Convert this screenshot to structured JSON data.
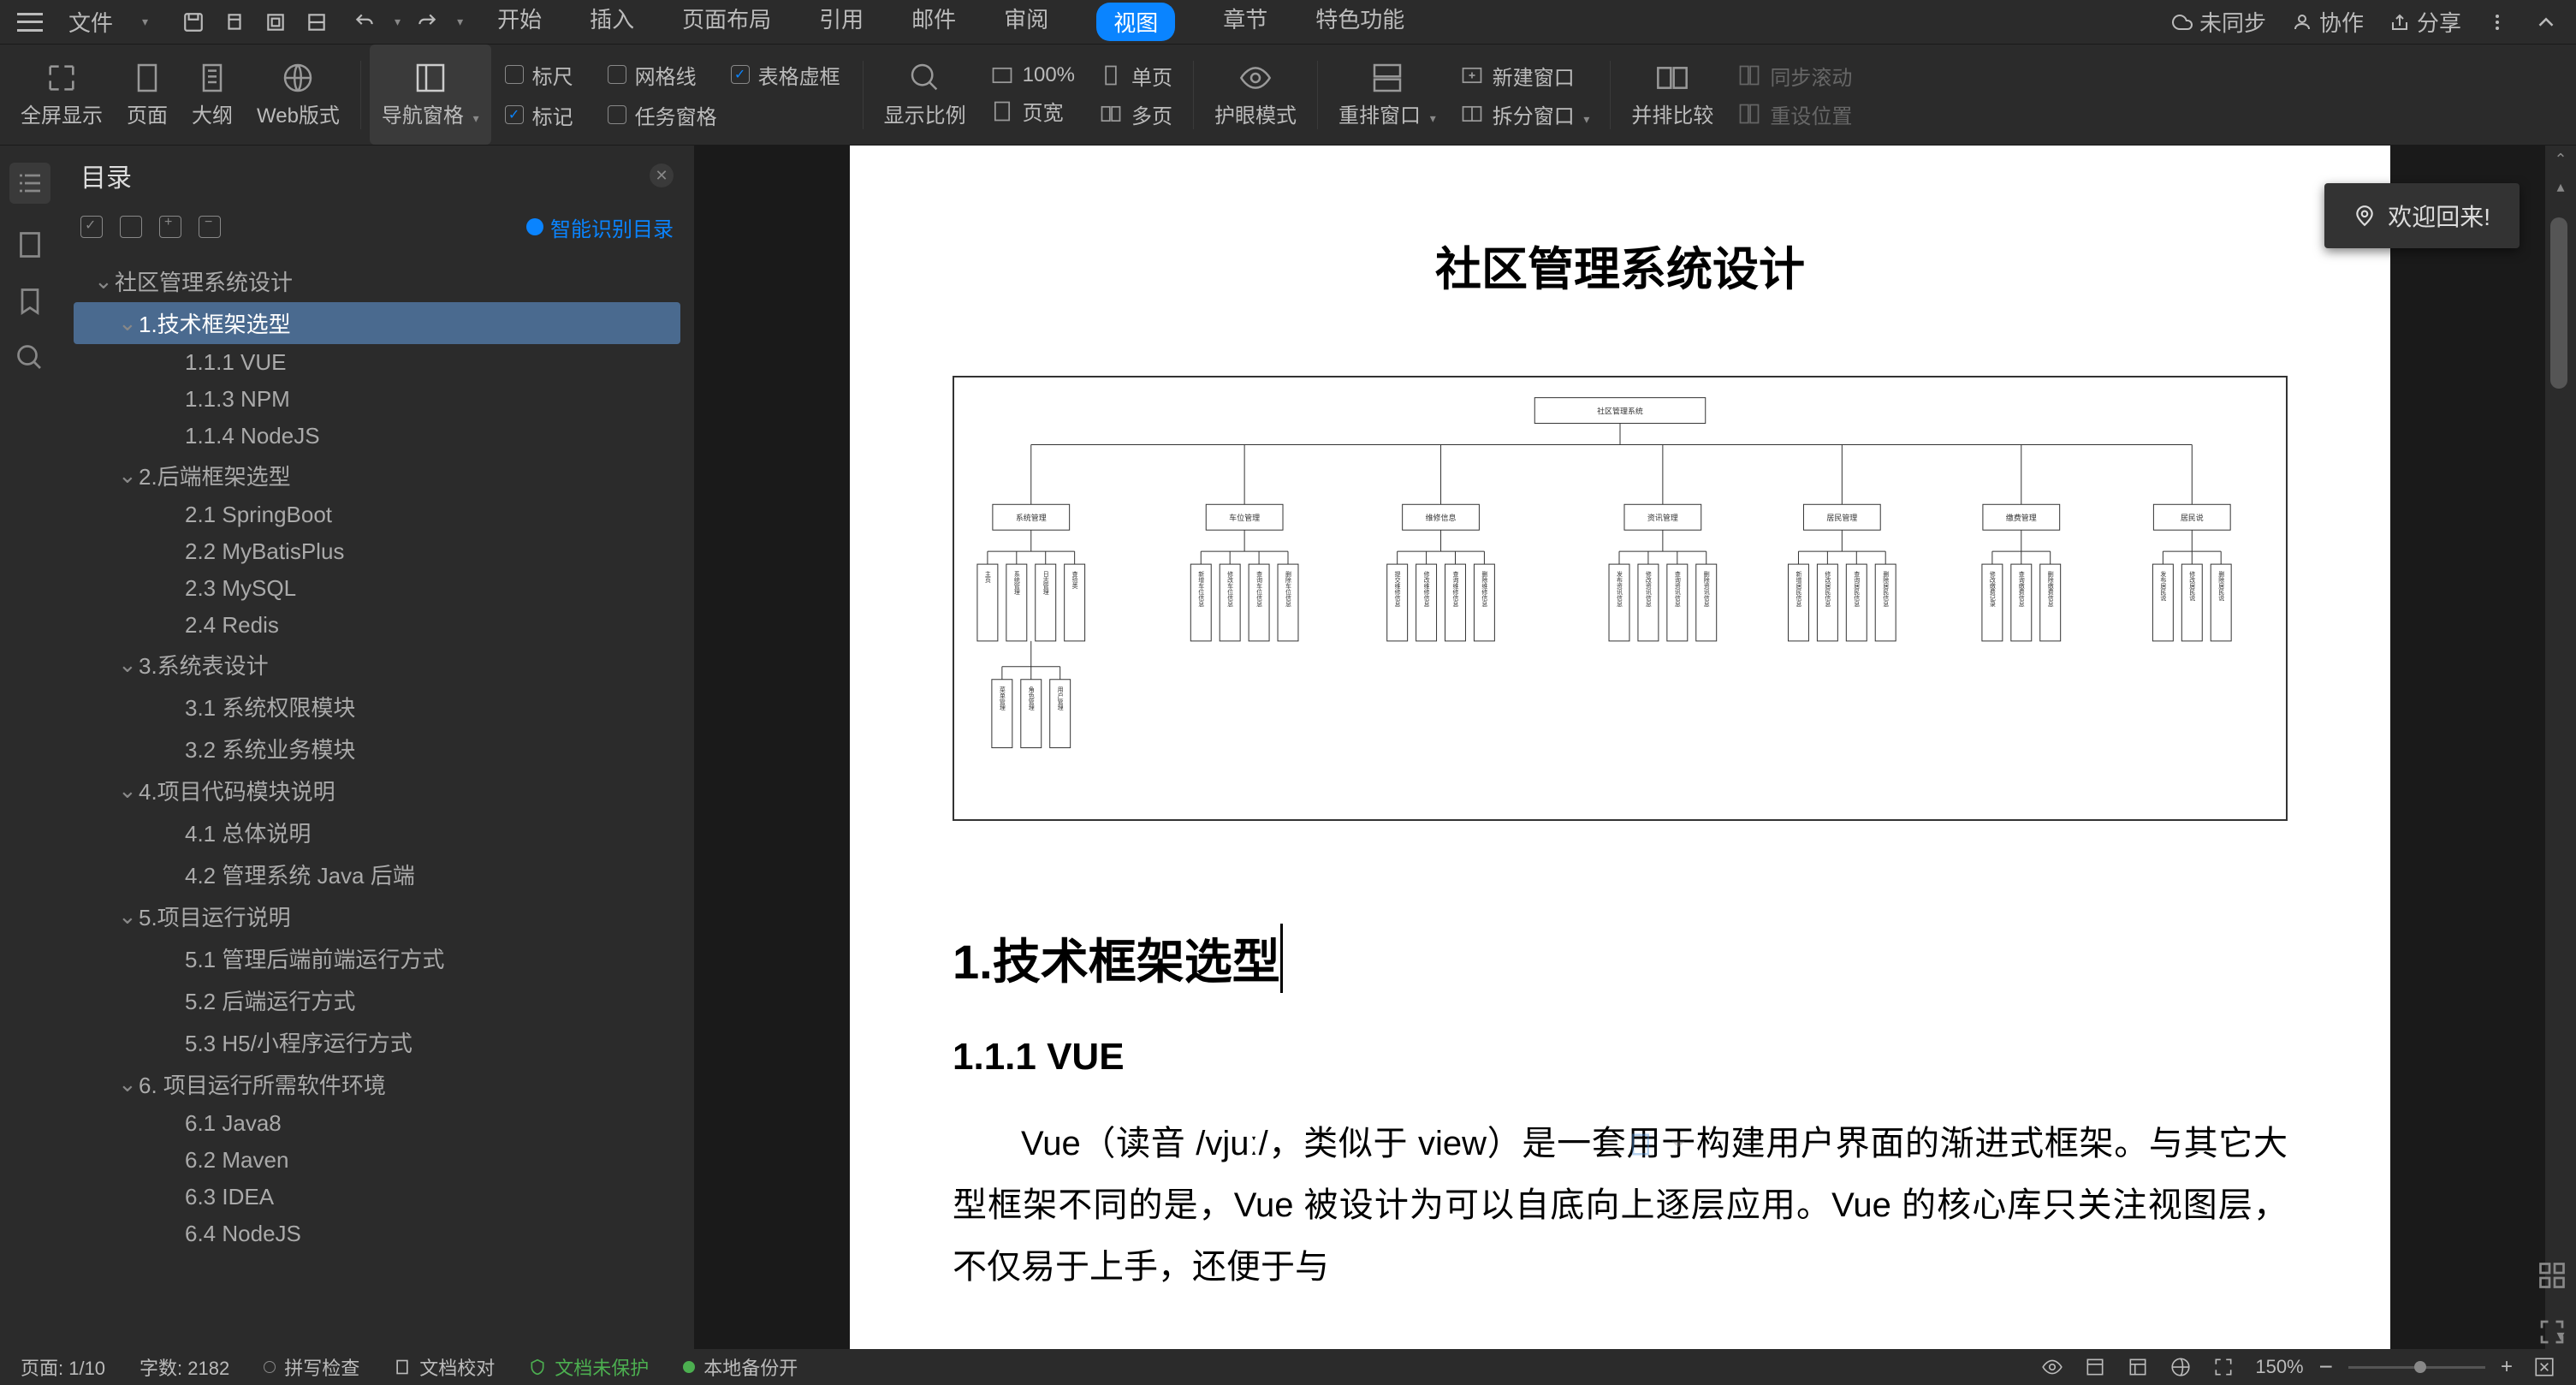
{
  "menu": {
    "file": "文件",
    "tabs": [
      "开始",
      "插入",
      "页面布局",
      "引用",
      "邮件",
      "审阅",
      "视图",
      "章节",
      "特色功能"
    ],
    "activeTab": "视图",
    "right": {
      "sync": "未同步",
      "collab": "协作",
      "share": "分享"
    }
  },
  "ribbon": {
    "views": {
      "fullscreen": "全屏显示",
      "page": "页面",
      "outline": "大纲",
      "web": "Web版式"
    },
    "navPane": "导航窗格",
    "checks": {
      "ruler": "标尺",
      "grid": "网格线",
      "table_dashed": "表格虚框",
      "mark": "标记",
      "task_pane": "任务窗格"
    },
    "zoom": {
      "scale": "显示比例",
      "pct": "100%",
      "single": "单页",
      "width": "页宽",
      "multi": "多页"
    },
    "eyecare": "护眼模式",
    "windows": {
      "rearrange": "重排窗口",
      "newwin": "新建窗口",
      "split": "拆分窗口",
      "sidebyside": "并排比较",
      "syncscroll": "同步滚动",
      "resetpos": "重设位置"
    }
  },
  "outline": {
    "title": "目录",
    "smart": "智能识别目录",
    "tree": [
      {
        "level": 0,
        "label": "社区管理系统设计",
        "chev": true
      },
      {
        "level": 1,
        "label": "1.技术框架选型",
        "chev": true,
        "selected": true
      },
      {
        "level": 2,
        "label": "1.1.1 VUE"
      },
      {
        "level": 2,
        "label": "1.1.3 NPM"
      },
      {
        "level": 2,
        "label": "1.1.4 NodeJS"
      },
      {
        "level": 1,
        "label": "2.后端框架选型",
        "chev": true
      },
      {
        "level": 2,
        "label": "2.1 SpringBoot"
      },
      {
        "level": 2,
        "label": "2.2 MyBatisPlus"
      },
      {
        "level": 2,
        "label": "2.3 MySQL"
      },
      {
        "level": 2,
        "label": "2.4 Redis"
      },
      {
        "level": 1,
        "label": "3.系统表设计",
        "chev": true
      },
      {
        "level": 2,
        "label": "3.1  系统权限模块"
      },
      {
        "level": 2,
        "label": "3.2  系统业务模块"
      },
      {
        "level": 1,
        "label": "4.项目代码模块说明",
        "chev": true
      },
      {
        "level": 2,
        "label": "4.1  总体说明"
      },
      {
        "level": 2,
        "label": "4.2  管理系统 Java 后端"
      },
      {
        "level": 1,
        "label": "5.项目运行说明",
        "chev": true
      },
      {
        "level": 2,
        "label": "5.1  管理后端前端运行方式"
      },
      {
        "level": 2,
        "label": "5.2  后端运行方式"
      },
      {
        "level": 2,
        "label": "5.3 H5/小程序运行方式"
      },
      {
        "level": 1,
        "label": "6.  项目运行所需软件环境",
        "chev": true
      },
      {
        "level": 2,
        "label": "6.1 Java8"
      },
      {
        "level": 2,
        "label": "6.2 Maven"
      },
      {
        "level": 2,
        "label": "6.3 IDEA"
      },
      {
        "level": 2,
        "label": "6.4 NodeJS"
      }
    ]
  },
  "doc": {
    "title": "社区管理系统设计",
    "diagram_root": "社区管理系统",
    "diagram_cats": [
      "系统管理",
      "车位管理",
      "维修信息",
      "资讯管理",
      "居民管理",
      "缴费管理",
      "居民说"
    ],
    "h1": "1.技术框架选型",
    "h2": "1.1.1 VUE",
    "body": "Vue（读音 /vjuː/，类似于 view）是一套用于构建用户界面的渐进式框架。与其它大型框架不同的是，Vue 被设计为可以自底向上逐层应用。Vue 的核心库只关注视图层，不仅易于上手，还便于与"
  },
  "welcome": "欢迎回来!",
  "status": {
    "page": "页面: 1/10",
    "words": "字数: 2182",
    "spell": "拼写检查",
    "proofread": "文档校对",
    "protect": "文档未保护",
    "backup": "本地备份开",
    "zoom": "150%"
  }
}
